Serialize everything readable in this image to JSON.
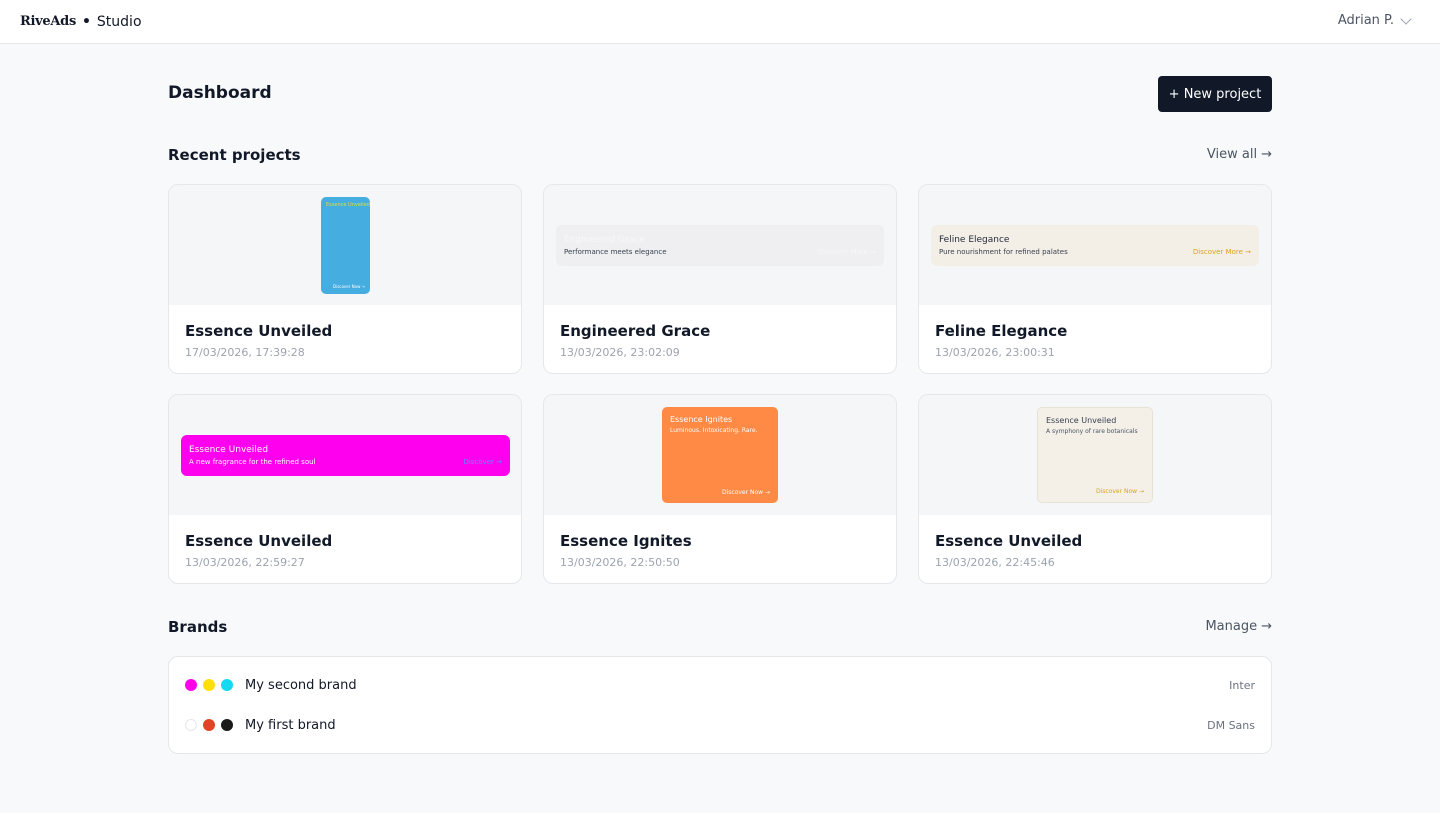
{
  "header": {
    "brand": "RiveAds",
    "separator": "•",
    "product": "Studio",
    "user": "Adrian P."
  },
  "dashboard": {
    "title": "Dashboard",
    "new_project_label": "+ New project"
  },
  "recent": {
    "title": "Recent projects",
    "view_all_label": "View all",
    "arrow": "→",
    "projects": [
      {
        "name": "Essence Unveiled",
        "date": "17/03/2026, 17:39:28",
        "preview": {
          "headline": "Essence Unveiled",
          "sub": "",
          "cta": "Discover Now →",
          "bg": "#45ade0",
          "headline_color": "#d9e23a",
          "text_color": "#ffffff"
        }
      },
      {
        "name": "Engineered Grace",
        "date": "13/03/2026, 23:02:09",
        "preview": {
          "headline": "Engineered Grace",
          "sub": "Performance meets elegance",
          "cta": "Discover More →",
          "bg": "#efeff1",
          "headline_color": "#f7f7f8",
          "text_color": "#374151"
        }
      },
      {
        "name": "Feline Elegance",
        "date": "13/03/2026, 23:00:31",
        "preview": {
          "headline": "Feline Elegance",
          "sub": "Pure nourishment for refined palates",
          "cta": "Discover More →",
          "bg": "#f4efe6",
          "headline_color": "#1f2937",
          "text_color": "#374151",
          "cta_color": "#d9a21b"
        }
      },
      {
        "name": "Essence Unveiled",
        "date": "13/03/2026, 22:59:27",
        "preview": {
          "headline": "Essence Unveiled",
          "sub": "A new fragrance for the refined soul",
          "cta": "Discover →",
          "bg": "#ff00ee",
          "headline_color": "#ffffff",
          "text_color": "#ffffff",
          "cta_color": "#5b8cff"
        }
      },
      {
        "name": "Essence Ignites",
        "date": "13/03/2026, 22:50:50",
        "preview": {
          "headline": "Essence Ignites",
          "sub": "Luminous. Intoxicating. Rare.",
          "cta": "Discover Now →",
          "bg": "#ff8a45",
          "headline_color": "#ffffff",
          "text_color": "#ffffff"
        }
      },
      {
        "name": "Essence Unveiled",
        "date": "13/03/2026, 22:45:46",
        "preview": {
          "headline": "Essence Unveiled",
          "sub": "A symphony of rare botanicals",
          "cta": "Discover Now →",
          "bg": "#f4f0e8",
          "headline_color": "#374151",
          "text_color": "#4b5563",
          "cta_color": "#d9a21b"
        }
      }
    ]
  },
  "brands": {
    "title": "Brands",
    "manage_label": "Manage",
    "arrow": "→",
    "items": [
      {
        "name": "My second brand",
        "font": "Inter",
        "colors": [
          "#ff00ee",
          "#ffde0a",
          "#15d9f0"
        ]
      },
      {
        "name": "My first brand",
        "font": "DM Sans",
        "colors": [
          "#ffffff",
          "#e04424",
          "#1a1a1a"
        ]
      }
    ]
  }
}
